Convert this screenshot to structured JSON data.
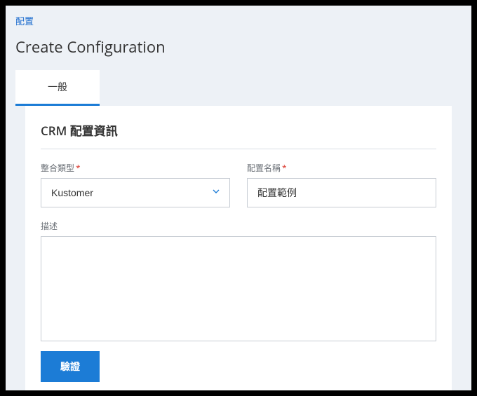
{
  "breadcrumb": {
    "label": "配置"
  },
  "page_title": "Create Configuration",
  "tabs": {
    "general": "一般"
  },
  "section": {
    "title": "CRM 配置資訊"
  },
  "fields": {
    "integration_type": {
      "label": "整合類型",
      "value": "Kustomer"
    },
    "config_name": {
      "label": "配置名稱",
      "value": "配置範例"
    },
    "description": {
      "label": "描述",
      "value": ""
    }
  },
  "buttons": {
    "validate": "驗證"
  },
  "required_mark": "*"
}
